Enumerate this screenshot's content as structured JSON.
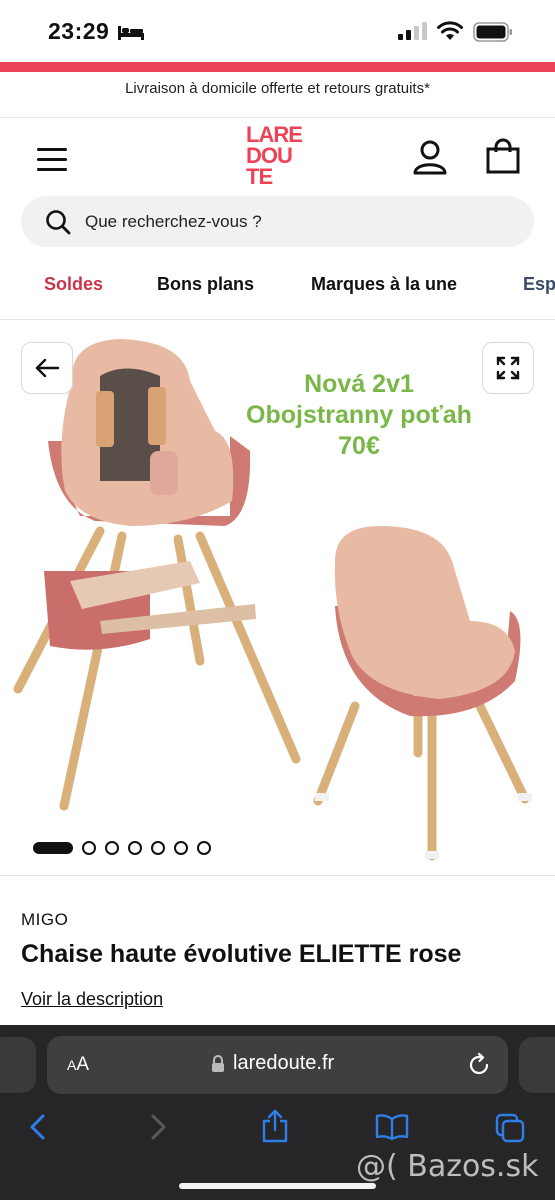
{
  "status_bar": {
    "time": "23:29",
    "icons": [
      "bed-icon",
      "signal-icon",
      "wifi-icon",
      "battery-icon"
    ]
  },
  "promo_banner": {
    "text": "Livraison à domicile offerte et retours gratuits*"
  },
  "header": {
    "logo_rows": [
      "LARE",
      "DOU",
      "TE"
    ],
    "icons": [
      "menu-icon",
      "user-icon",
      "bag-icon"
    ]
  },
  "search": {
    "placeholder": "Que recherchez-vous ?",
    "value": ""
  },
  "categories": [
    {
      "label": "Soldes",
      "color": "#c9344a"
    },
    {
      "label": "Bons plans"
    },
    {
      "label": "Marques à la une"
    },
    {
      "label": "Esp"
    }
  ],
  "gallery": {
    "overlay_text": [
      "Nová 2v1",
      "Obojstranny poťah",
      "70€"
    ],
    "current_index": 1,
    "total_images": 7
  },
  "product": {
    "brand": "MIGO",
    "title": "Chaise haute évolutive ELIETTE rose",
    "description_link": "Voir la description"
  },
  "browser": {
    "aa_label": "AA",
    "url": "laredoute.fr",
    "watermark": "@( Bazos.sk"
  },
  "colors": {
    "accent": "#ee4357",
    "overlay_green": "#7ab648",
    "chair_pink": "#cf7a73",
    "wood": "#d9b07a"
  }
}
